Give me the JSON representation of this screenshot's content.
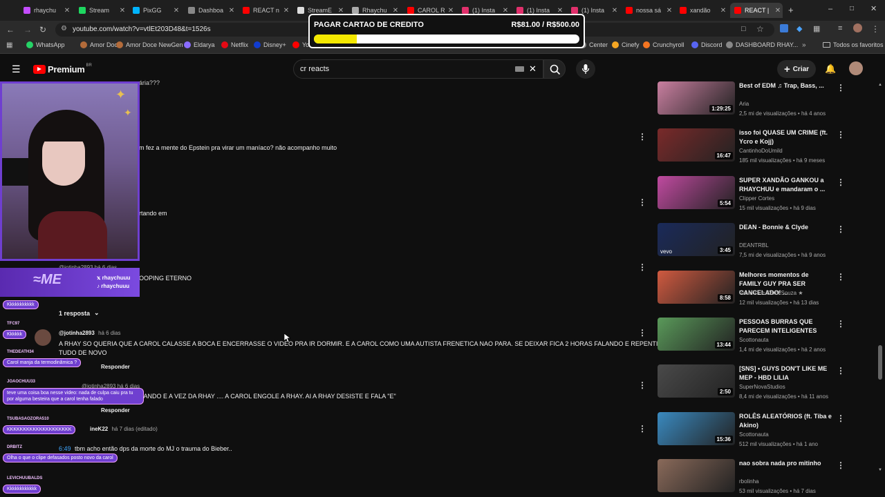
{
  "tabs": [
    {
      "label": "rhaychu",
      "color": "#c44dff"
    },
    {
      "label": "Stream",
      "color": "#1ed760"
    },
    {
      "label": "PixGG",
      "color": "#00b4ff"
    },
    {
      "label": "Dashboa",
      "color": "#888888"
    },
    {
      "label": "REACT n",
      "color": "#ff0000"
    },
    {
      "label": "StreamE",
      "color": "#dddddd"
    },
    {
      "label": "Rhaychu",
      "color": "#aaaaaa"
    },
    {
      "label": "CAROL R",
      "color": "#ff0000"
    },
    {
      "label": "(1) Insta",
      "color": "#e1306c"
    },
    {
      "label": "(1) Insta",
      "color": "#e1306c"
    },
    {
      "label": "(1) Insta",
      "color": "#e1306c"
    },
    {
      "label": "nossa sá",
      "color": "#ff0000"
    },
    {
      "label": "xandão",
      "color": "#ff0000"
    },
    {
      "label": "REACT |",
      "color": "#ff0000"
    }
  ],
  "address": {
    "url": "youtube.com/watch?v=vtlEt203D48&t=1526s"
  },
  "bookmarks": [
    {
      "label": "WhatsApp",
      "color": "#25d366"
    },
    {
      "label": "Amor Doce",
      "color": "#b36b3a"
    },
    {
      "label": "Amor Doce NewGen",
      "color": "#b36b3a"
    },
    {
      "label": "Eldarya",
      "color": "#8a6cff"
    },
    {
      "label": "Netflix",
      "color": "#e50914"
    },
    {
      "label": "Disney+",
      "color": "#113ccf"
    },
    {
      "label": "Yo",
      "color": "#ff0000"
    }
  ],
  "bookmarks_right": [
    {
      "label": "Center",
      "color": "#888888"
    },
    {
      "label": "Cinefy",
      "color": "#f5a623"
    },
    {
      "label": "Crunchyroll",
      "color": "#f47521"
    },
    {
      "label": "Discord",
      "color": "#5865f2"
    },
    {
      "label": "DASHBOARD RHAY...",
      "color": "#888888"
    }
  ],
  "all_bookmarks": "Todos os favoritos",
  "yt": {
    "logo": "Premium",
    "region": "BR",
    "search_value": "cr reacts",
    "create_label": "Criar"
  },
  "progress_overlay": {
    "title": "PAGAR CARTAO DE CREDITO",
    "amount": "R$81.00 / R$500.00",
    "fraction": 0.162
  },
  "comments": [
    {
      "text": "ária???"
    },
    {
      "text": "m fez a mente do Epstein pra virar um maníaco? não acompanho muito"
    },
    {
      "text": "rtando em"
    },
    {
      "text": "@jotinha2893 há 6 dias"
    },
    {
      "text": "OOPING ETERNO"
    },
    {
      "replies": "1 resposta"
    },
    {
      "author": "@jotinha2893",
      "time": "há 6 dias",
      "text1": "A RHAY SO QUERIA QUE A CAROL CALASSE A BOCA E ENCERRASSE O VIDEO PRA IR DORMIR. E A CAROL COMO UMA AUTISTA FRENETICA NAO PARA. SE DEIXAR FICA 2 HORAS FALANDO E REPENTINDO",
      "text2": "TUDO DE NOVO",
      "reply": "Responder"
    },
    {
      "author": "@jotinha2893 há 6 dias"
    },
    {
      "text": "UANDO E A VEZ DA RHAY .... A CAROL ENGOLE A RHAY.  AI A RHAY DESISTE E FALA  \"E\"",
      "reply": "Responder"
    },
    {
      "author": "ineK22",
      "time": "há 7 dias (editado)",
      "timestamp": "6:49",
      "text": "tbm acho então dps da morte do MJ o trauma do Bieber.."
    }
  ],
  "sidebar": [
    {
      "title": "Best of EDM ♫ Trap, Bass, ...",
      "channel": "Aria",
      "stats": "2,5 mi de visualizações • há 4 anos",
      "duration": "1:29:25",
      "color": "#c97fa0"
    },
    {
      "title": "isso foi QUASE UM CRIME (ft. Ycro e Kojj)",
      "channel": "CantinhoDoUmild",
      "stats": "185 mil visualizações • há 9 meses",
      "duration": "16:47",
      "color": "#7a2a2a"
    },
    {
      "title": "SUPER XANDÃO GANKOU a RHAYCHUU e mandaram o ...",
      "channel": "Clipper Cortes",
      "stats": "15 mil visualizações • há 9 dias",
      "duration": "5:54",
      "color": "#c04aa0"
    },
    {
      "title": "DEAN - Bonnie & Clyde",
      "channel": "DEANTRBL",
      "stats": "7,5 mi de visualizações • há 9 anos",
      "duration": "3:45",
      "color": "#1a2a5a",
      "badge": "vevo"
    },
    {
      "title": "Melhores momentos de FAMILY GUY PRA SER CANCELADO! ...",
      "channel": "Vic MV • e Carol Souza ★",
      "stats": "12 mil visualizações • há 13 dias",
      "duration": "8:58",
      "color": "#d05a40"
    },
    {
      "title": "PESSOAS BURRAS QUE PARECEM INTELIGENTES",
      "channel": "Scottonauta",
      "stats": "1,4 mi de visualizações • há 2 anos",
      "duration": "13:44",
      "color": "#5a9a5a"
    },
    {
      "title": "[SNS] • GUYS DON'T LIKE ME MEP - HBD LILIA",
      "channel": "SuperNovaStudios",
      "stats": "8,4 mi de visualizações • há 11 anos",
      "duration": "2:50",
      "color": "#4a4a4a"
    },
    {
      "title": "ROLÊS ALEATÓRIOS (ft. Tiba e Akino)",
      "channel": "Scottonauta",
      "stats": "512 mil visualizações • há 1 ano",
      "duration": "15:36",
      "color": "#3a8ac0"
    },
    {
      "title": "nao sobra nada pro mitinho",
      "channel": "rbolinha",
      "stats": "53 mil visualizações • há 7 dias",
      "duration": "",
      "color": "#8a6a5a"
    }
  ],
  "overlay_social": [
    "rhaychuuu",
    "rhaychuuu"
  ],
  "chat": [
    {
      "name": "",
      "msg": "Kkkkkkkkkkk"
    },
    {
      "name": "TFC97",
      "msg": "Kkkkkk"
    },
    {
      "name": "THEDEATH34",
      "msg": "Carol manja da termodinâmica ?"
    },
    {
      "name": "JOAOCHUU33",
      "msg": "teve uma coisa boa nesse video: nada de culpa caiu pra tu por alguma besteira que a carol tenha falado"
    },
    {
      "name": "TSUBASAOZORA510",
      "msg": "KKKKKKKKKKKKKKKKKKKK"
    },
    {
      "name": "DRBITZ",
      "msg": "Olha o que o clipe defasados posto novo da carol"
    },
    {
      "name": "LEVICHUUBALDS",
      "msg": "Kkkkkkkkkkkk"
    }
  ]
}
